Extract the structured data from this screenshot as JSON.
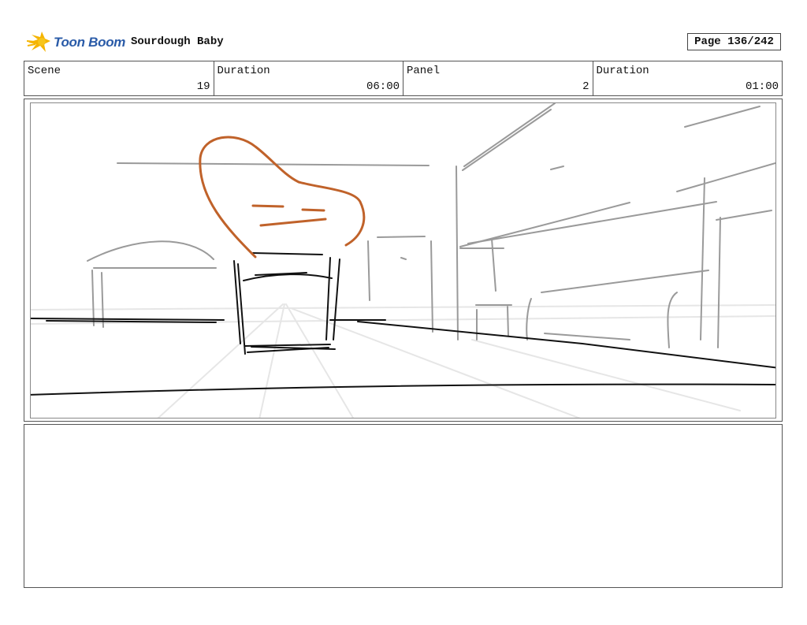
{
  "header": {
    "logo_text": "Toon Boom",
    "project_title": "Sourdough Baby",
    "page": "Page 136/242"
  },
  "info": [
    {
      "label": "Scene",
      "value": "19"
    },
    {
      "label": "Duration",
      "value": "06:00"
    },
    {
      "label": "Panel",
      "value": "2"
    },
    {
      "label": "Duration",
      "value": "01:00"
    }
  ],
  "colors": {
    "logo_blue": "#2a5ba8",
    "logo_yellow": "#f5b400",
    "sketch_orange": "#c0622a",
    "sketch_black": "#111111",
    "sketch_gray": "#8c8c8c"
  },
  "icons": {
    "logo": "toon-boom-star-logo-icon"
  },
  "notes": ""
}
